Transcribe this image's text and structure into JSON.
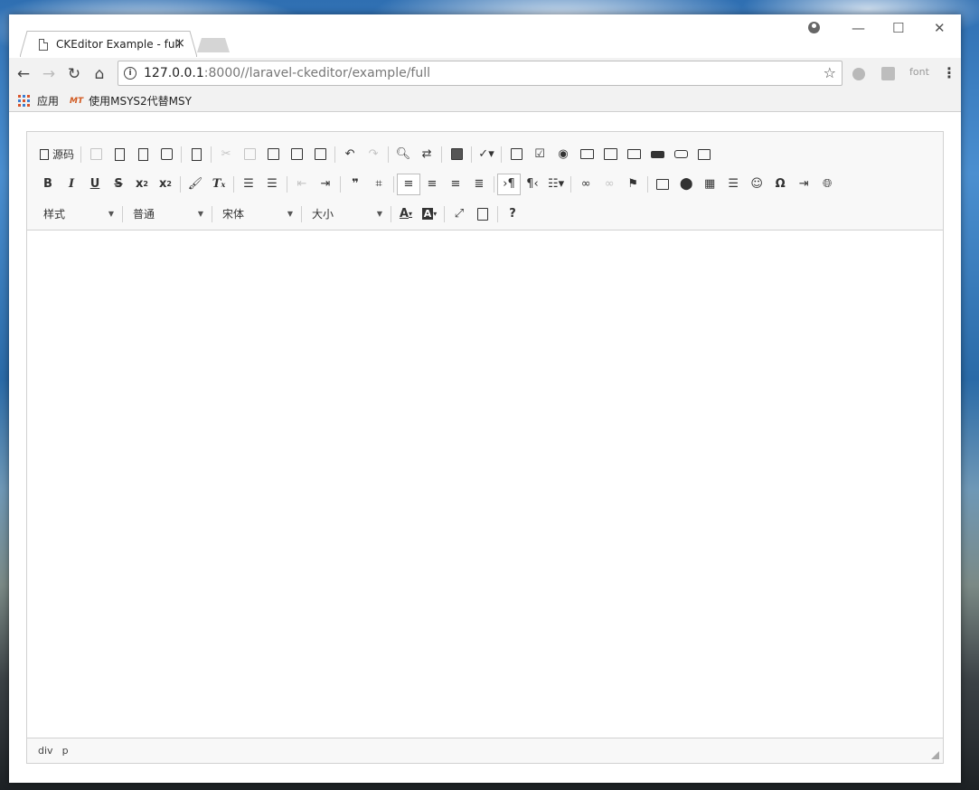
{
  "browser": {
    "tab_title": "CKEditor Example - full",
    "tab_close": "×",
    "url_host": "127.0.0.1",
    "url_rest": ":8000//laravel-ckeditor/example/full",
    "extensions": {
      "font_label": "font"
    },
    "bookmarks": [
      {
        "label": "应用"
      },
      {
        "label": "使用MSYS2代替MSY",
        "badge": "MT"
      }
    ],
    "window_controls": {
      "minimize": "—",
      "maximize": "☐",
      "close": "✕"
    }
  },
  "editor": {
    "source_label": "源码",
    "combos": {
      "styles": "样式",
      "format": "普通",
      "font": "宋体",
      "size": "大小"
    },
    "elements_path": [
      "div",
      "p"
    ]
  },
  "colors": {
    "toolbar_bg": "#f8f8f8",
    "border": "#d1d1d1",
    "chrome_bar": "#f2f2f2"
  }
}
